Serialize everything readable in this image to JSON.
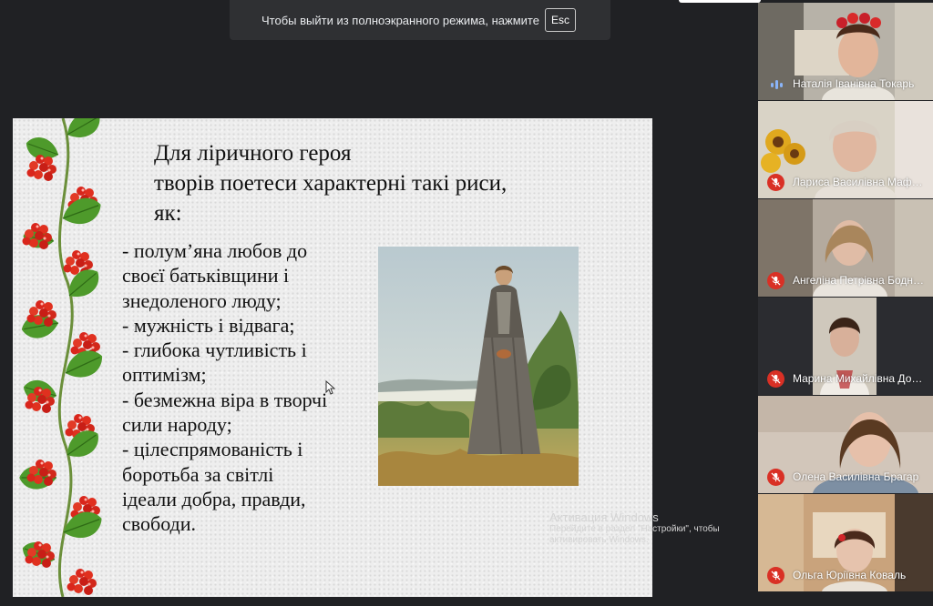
{
  "fullscreen_notice": {
    "text": "Чтобы выйти из полноэкранного режима, нажмите",
    "key": "Esc"
  },
  "slide": {
    "title_lines": [
      "Для ліричного героя",
      "творів поетеси характерні такі риси,",
      "як:"
    ],
    "bullets": [
      "- полум’яна любов до",
      "своєї батьківщини і",
      "знедоленого люду;",
      "- мужність і відвага;",
      "- глибока чутливість і",
      "оптимізм;",
      "- безмежна віра в творчі",
      "сили народу;",
      "- цілеспрямованість і",
      "боротьба за світлі",
      "ідеали добра, правди,",
      "свободи."
    ]
  },
  "windows_activation": {
    "title": "Активация Windows",
    "line1": "Перейдите в раздел \"Настройки\", чтобы",
    "line2": "активировать Windows."
  },
  "participants": [
    {
      "name": "Наталія Іванівна Токарь",
      "state": "speaking"
    },
    {
      "name": "Лариса Василівна Маф…",
      "state": "muted"
    },
    {
      "name": "Ангеліна Петрівна Бодн…",
      "state": "muted"
    },
    {
      "name": "Марина Михайлівна До…",
      "state": "muted"
    },
    {
      "name": "Олена Василівна Брагар",
      "state": "muted"
    },
    {
      "name": "Ольга Юріївна Коваль",
      "state": "muted"
    }
  ],
  "colors": {
    "app_background": "#202124",
    "muted_badge": "#d93025",
    "speaking_indicator": "#8ab4f8"
  }
}
